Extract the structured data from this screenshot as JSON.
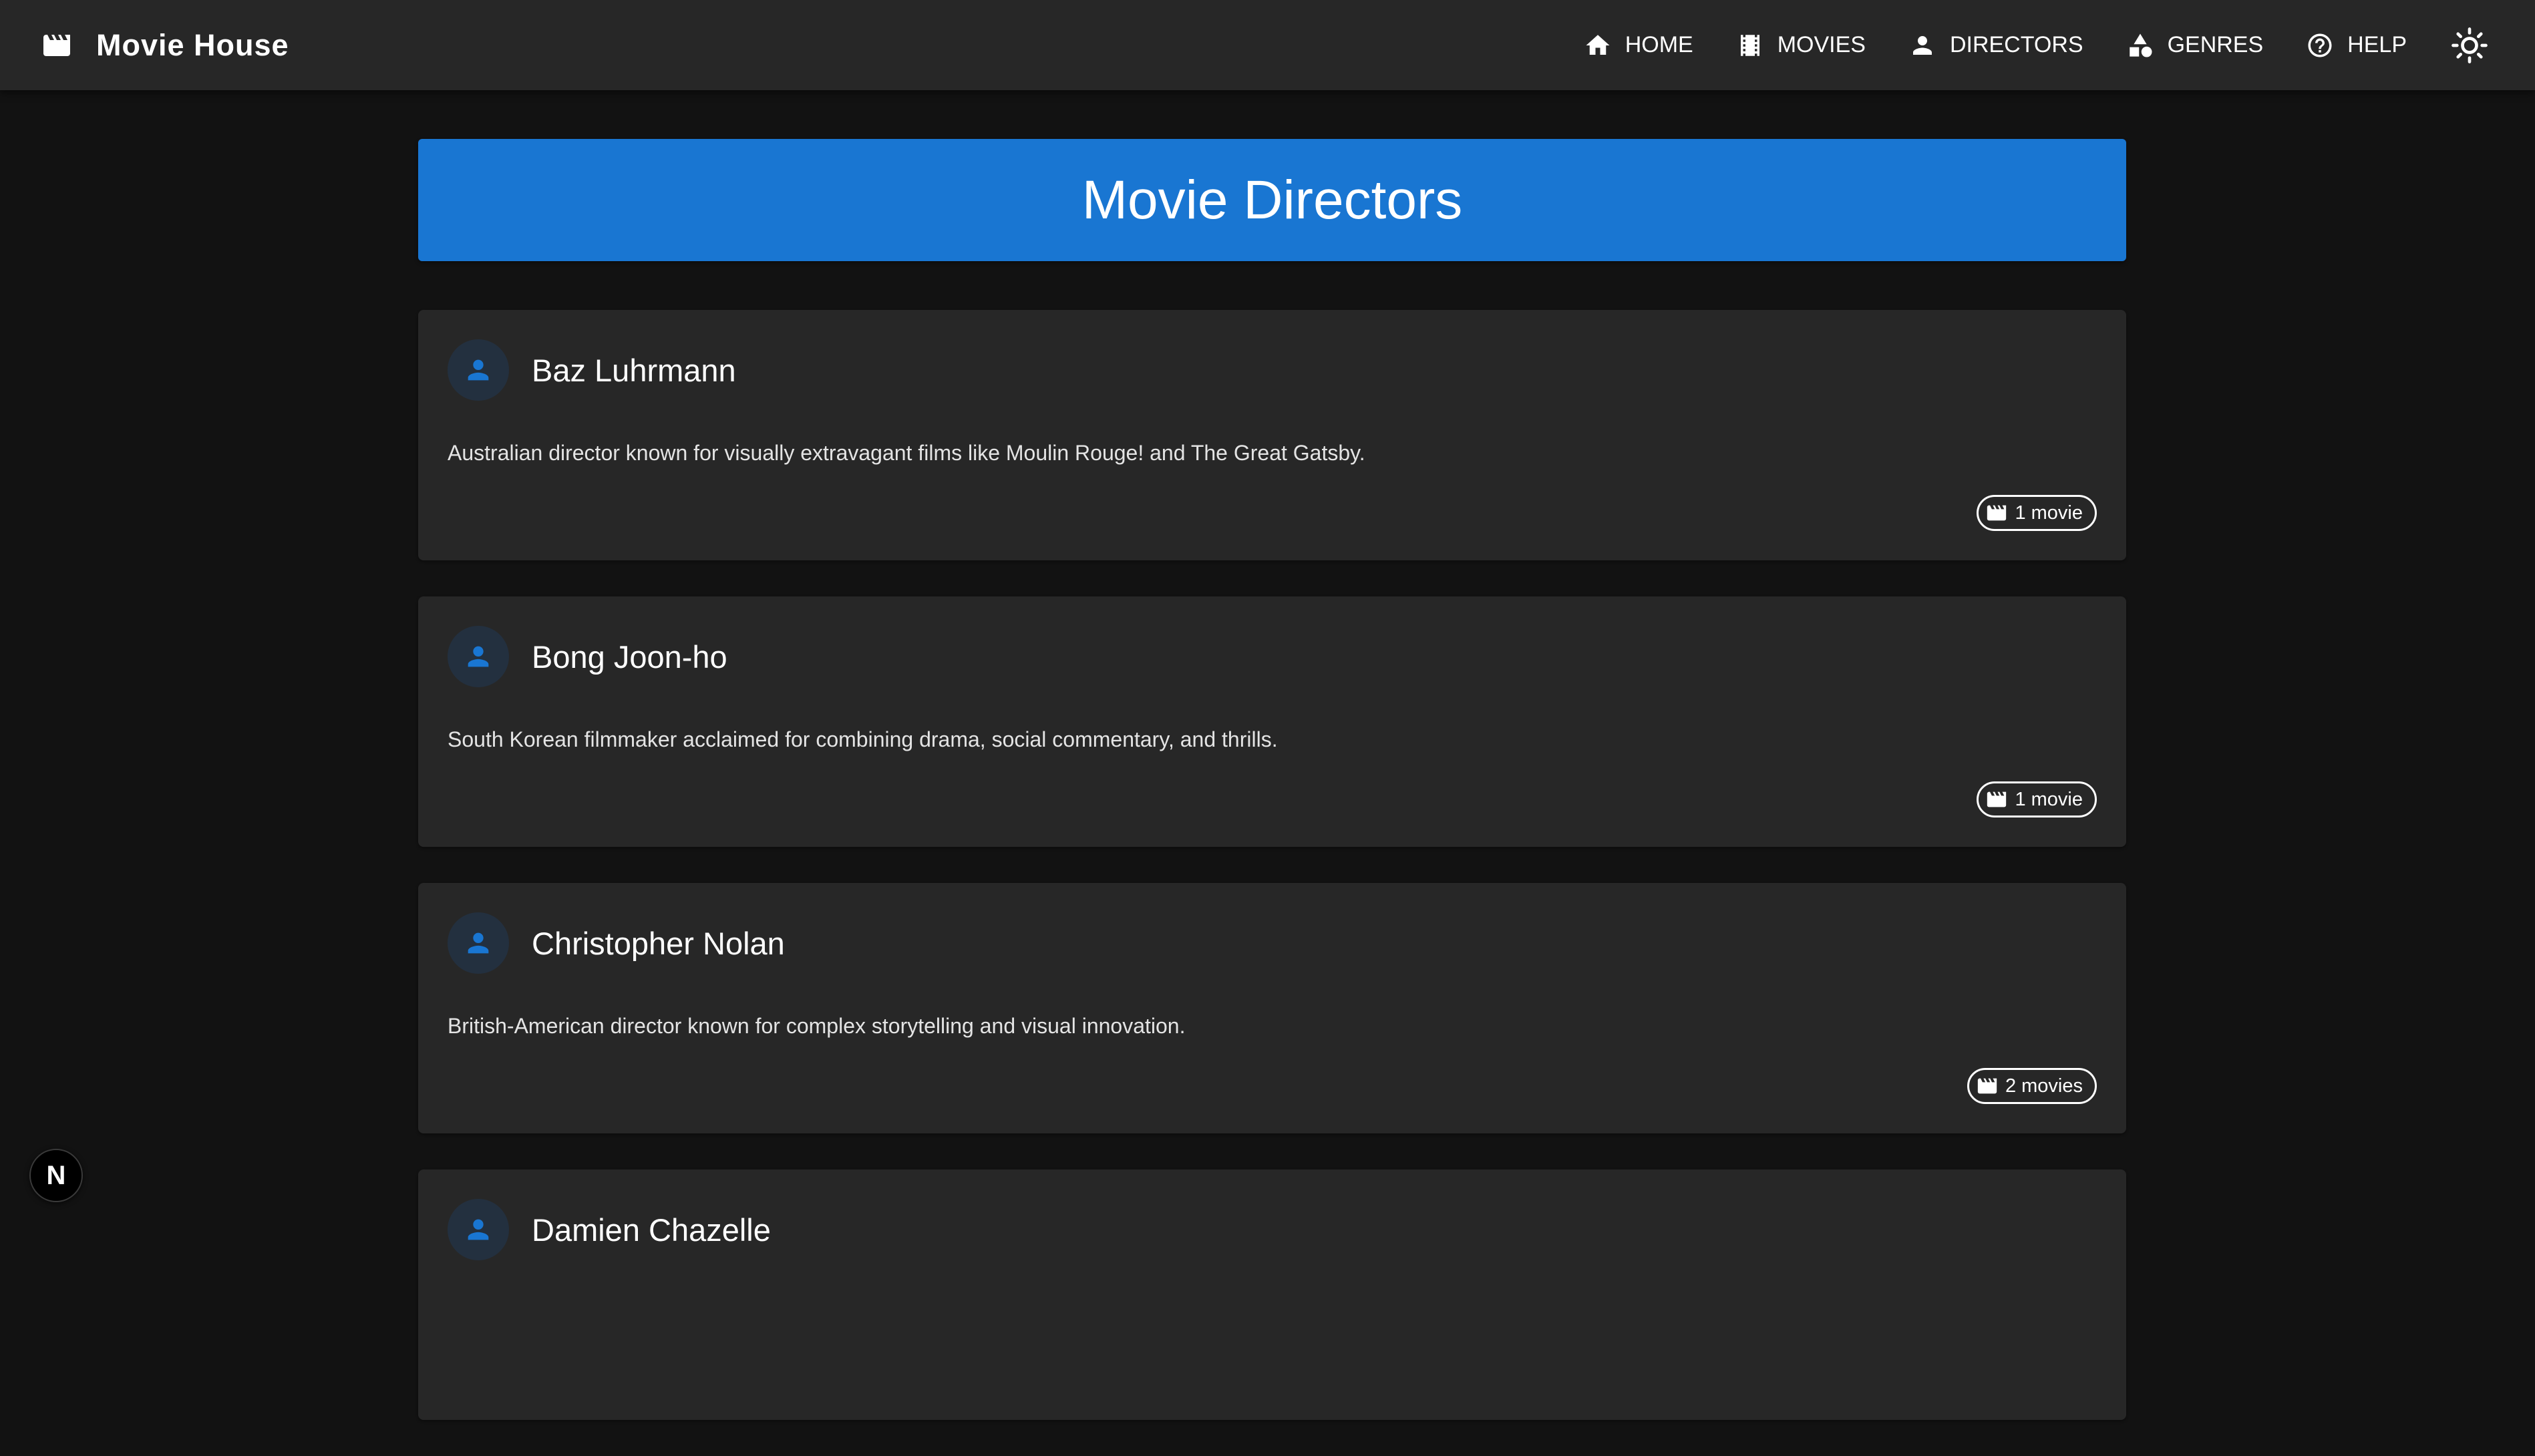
{
  "app": {
    "title": "Movie House"
  },
  "nav": {
    "items": [
      {
        "label": "HOME",
        "icon": "home-icon"
      },
      {
        "label": "MOVIES",
        "icon": "film-icon"
      },
      {
        "label": "DIRECTORS",
        "icon": "person-icon"
      },
      {
        "label": "GENRES",
        "icon": "category-icon"
      },
      {
        "label": "HELP",
        "icon": "help-icon"
      }
    ],
    "theme_toggle_icon": "sun-icon"
  },
  "page": {
    "title": "Movie Directors"
  },
  "directors": [
    {
      "name": "Baz Luhrmann",
      "bio": "Australian director known for visually extravagant films like Moulin Rouge! and The Great Gatsby.",
      "movie_count": "1 movie"
    },
    {
      "name": "Bong Joon-ho",
      "bio": "South Korean filmmaker acclaimed for combining drama, social commentary, and thrills.",
      "movie_count": "1 movie"
    },
    {
      "name": "Christopher Nolan",
      "bio": "British-American director known for complex storytelling and visual innovation.",
      "movie_count": "2 movies"
    },
    {
      "name": "Damien Chazelle",
      "bio": "",
      "movie_count": ""
    }
  ],
  "dev_badge": {
    "letter": "N"
  },
  "colors": {
    "appbar": "#272727",
    "background": "#121212",
    "accent": "#1976d2",
    "card": "#272727",
    "text": "#ffffff"
  }
}
